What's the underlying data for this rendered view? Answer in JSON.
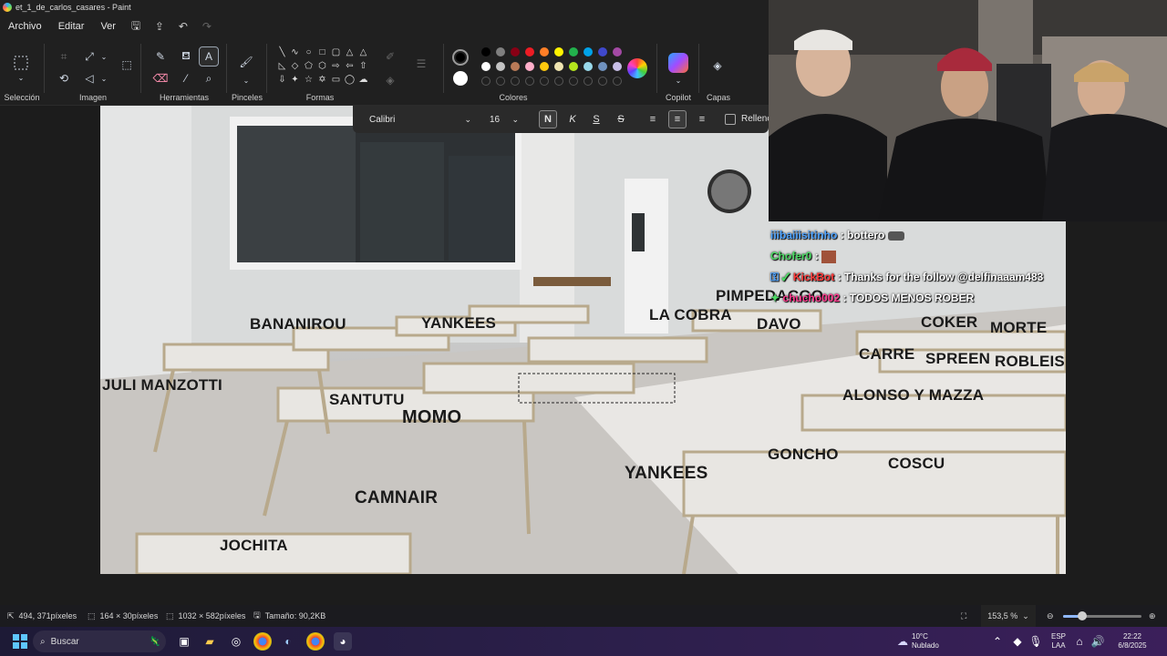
{
  "window": {
    "title": "et_1_de_carlos_casares - Paint"
  },
  "menu": {
    "file": "Archivo",
    "edit": "Editar",
    "view": "Ver"
  },
  "ribbon": {
    "groups": {
      "selection": "Selección",
      "image": "Imagen",
      "tools": "Herramientas",
      "brushes": "Pinceles",
      "shapes": "Formas",
      "colors": "Colores",
      "copilot": "Copilot",
      "layers": "Capas"
    },
    "palette_row1": [
      "#000000",
      "#7f7f7f",
      "#880015",
      "#ed1c24",
      "#ff7f27",
      "#fff200",
      "#22b14c",
      "#00a2e8",
      "#3f48cc",
      "#a349a4"
    ],
    "palette_row2": [
      "#ffffff",
      "#c3c3c3",
      "#b97a57",
      "#ffaec9",
      "#ffc90e",
      "#efe4b0",
      "#b5e61d",
      "#99d9ea",
      "#7092be",
      "#c8bfe7"
    ],
    "color1": "#000000",
    "color2": "#ffffff"
  },
  "text_toolbar": {
    "font": "Calibri",
    "size": "16",
    "bold": "N",
    "italic": "K",
    "underline": "S",
    "strike": "S",
    "fill_label": "Relleno"
  },
  "canvas_labels": [
    "BANANIROU",
    "YANKEES",
    "LA COBRA",
    "PIMPEDACGO",
    "DAVO",
    "COKER",
    "MORTE",
    "CARRE",
    "SPREEN",
    "ROBLEIS",
    "JULI MANZOTTI",
    "SANTUTU",
    "MOMO",
    "ALONSO Y MAZZA",
    "GONCHO",
    "COSCU",
    "YANKEES",
    "CAMNAIR",
    "JOCHITA"
  ],
  "chat": [
    {
      "user": "iiibaiiisitinho",
      "user_color": "#4fa3ff",
      "text": ": bottero"
    },
    {
      "user": "Chofer0",
      "user_color": "#4cd964",
      "text": ":"
    },
    {
      "user": "KickBot",
      "user_color": "#ff3b3b",
      "text": ": Thanks for the follow @delfinaaam483"
    },
    {
      "user": "chucho002",
      "user_color": "#ff3b8f",
      "text": ": TODOS MENOS ROBER"
    }
  ],
  "status": {
    "cursor": "494, 371píxeles",
    "selection": "164 × 30píxeles",
    "canvas_size": "1032 × 582píxeles",
    "file_size": "Tamaño: 90,2KB",
    "zoom": "153,5 %"
  },
  "taskbar": {
    "search_placeholder": "Buscar",
    "weather_temp": "10°C",
    "weather_desc": "Nublado",
    "lang_top": "ESP",
    "lang_bottom": "LAA",
    "time": "22:22",
    "date": "6/8/2025"
  }
}
